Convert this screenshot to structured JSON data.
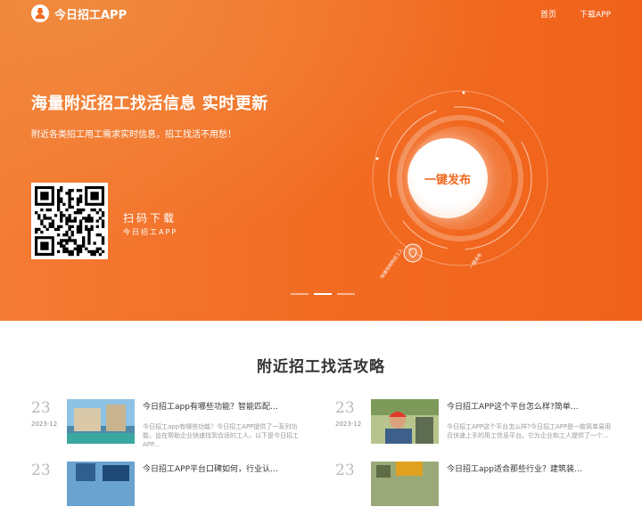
{
  "header": {
    "logo_text": "今日招工APP",
    "nav": [
      "首页",
      "下载APP"
    ]
  },
  "hero": {
    "headline": "海量附近招工找活信息 实时更新",
    "subline": "附近各类招工用工需求实时信息，招工找活不用愁！",
    "qr_title": "扫码下载",
    "qr_sub": "今日招工APP",
    "publish_button": "一键发布",
    "ring_labels": [
      "快速找到附近工人",
      "一键发布"
    ],
    "carousel_active_index": 1
  },
  "colors": {
    "accent": "#f26a21",
    "accent_light": "#f47b34",
    "text_dark": "#333333",
    "text_muted": "#999999"
  },
  "section": {
    "title": "附近招工找活攻略"
  },
  "articles": [
    {
      "day": "23",
      "month": "2023-12",
      "title": "今日招工app有哪些功能？智能匹配…",
      "excerpt": "今日招工app有哪些功能？今日招工APP提供了一系列功能，旨在帮助企业快速找到合适的工人。以下是今日招工APP..."
    },
    {
      "day": "23",
      "month": "2023-12",
      "title": "今日招工APP这个平台怎么样?简单…",
      "excerpt": "今日招工APP这个平台怎么样?今日招工APP是一款简单易用且快速上手的用工信息平台。它为企业和工人提供了一个..."
    },
    {
      "day": "23",
      "month": "",
      "title": "今日招工APP平台口碑如何，行业认…",
      "excerpt": ""
    },
    {
      "day": "23",
      "month": "",
      "title": "今日招工app适合那些行业？建筑装…",
      "excerpt": ""
    }
  ]
}
